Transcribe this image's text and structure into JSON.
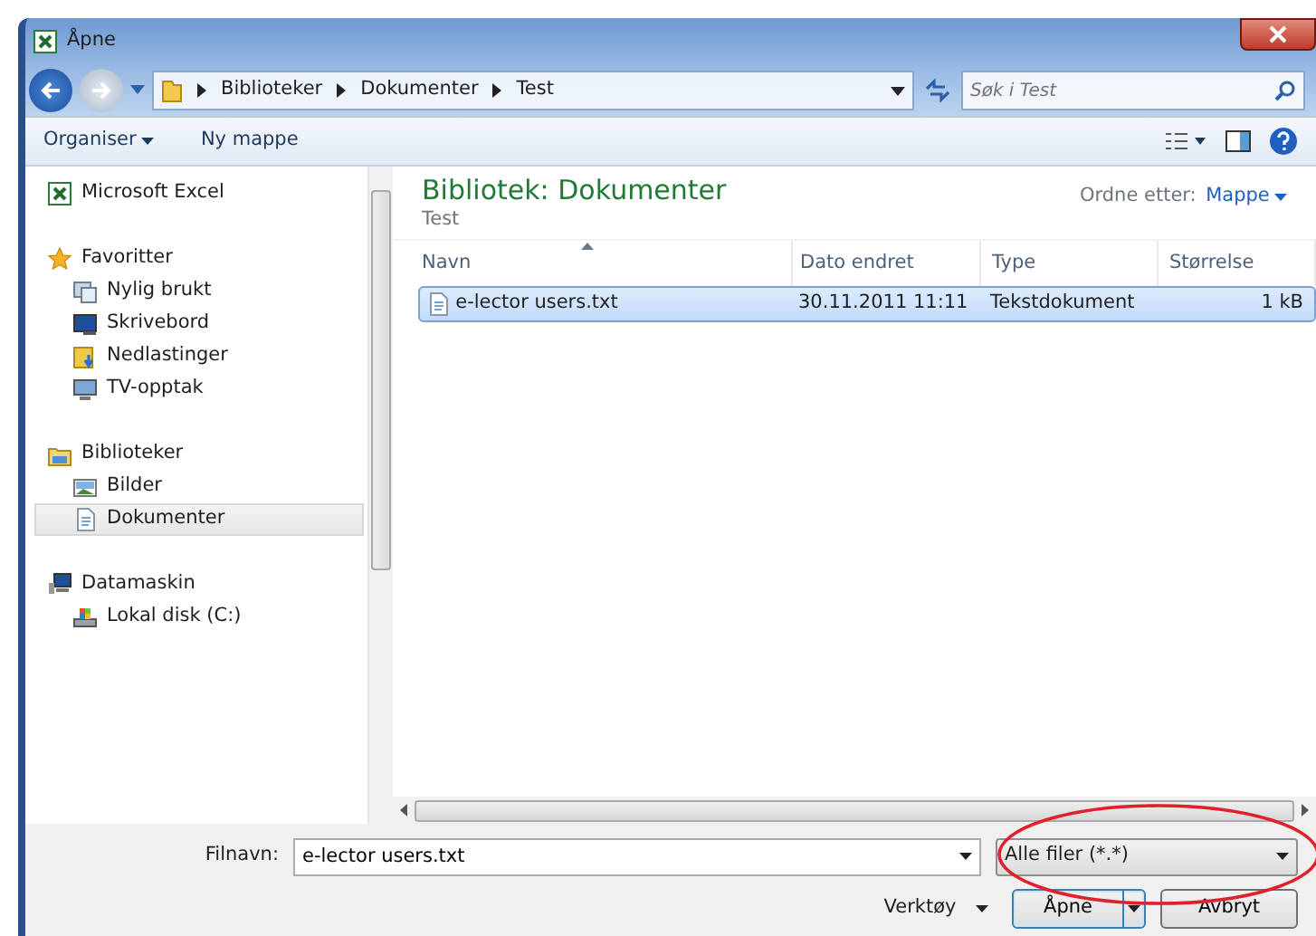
{
  "window": {
    "title": "Åpne"
  },
  "address": {
    "path": [
      "Biblioteker",
      "Dokumenter",
      "Test"
    ]
  },
  "search": {
    "placeholder": "Søk i Test"
  },
  "toolbar": [
    {
      "label": "Organiser",
      "has_menu": true
    },
    {
      "label": "Ny mappe",
      "has_menu": false
    }
  ],
  "sidebar": {
    "groups": [
      {
        "label": "Microsoft Excel",
        "selected": false
      },
      {
        "label": "Favoritter",
        "selected": false,
        "children": [
          {
            "label": "Nylig brukt",
            "selected": false
          },
          {
            "label": "Skrivebord",
            "selected": false
          },
          {
            "label": "Nedlastinger",
            "selected": false
          },
          {
            "label": "TV-opptak",
            "selected": false
          }
        ]
      },
      {
        "label": "Biblioteker",
        "selected": false,
        "children": [
          {
            "label": "Bilder",
            "selected": false
          },
          {
            "label": "Dokumenter",
            "selected": true
          }
        ]
      },
      {
        "label": "Datamaskin",
        "selected": false,
        "children": [
          {
            "label": "Lokal disk (C:)",
            "selected": false
          }
        ]
      }
    ]
  },
  "library": {
    "title": "Bibliotek: Dokumenter",
    "subtitle": "Test",
    "arrange_label": "Ordne etter:",
    "arrange_value": "Mappe"
  },
  "table": {
    "columns": [
      {
        "label": "Navn",
        "sorted": true
      },
      {
        "label": "Dato endret",
        "sorted": false
      },
      {
        "label": "Type",
        "sorted": false
      },
      {
        "label": "Størrelse",
        "sorted": false
      }
    ],
    "rows": [
      {
        "name": "e-lector users.txt",
        "date": "30.11.2011 11:11",
        "type": "Tekstdokument",
        "size": "1 kB",
        "selected": true
      }
    ]
  },
  "filename": {
    "label": "Filnavn:",
    "value": "e-lector users.txt"
  },
  "filter": {
    "value": "Alle filer (*.*)"
  },
  "tools": {
    "label": "Verktøy"
  },
  "buttons": [
    {
      "label": "Åpne",
      "kind": "split"
    },
    {
      "label": "Avbryt",
      "kind": "plain"
    }
  ]
}
